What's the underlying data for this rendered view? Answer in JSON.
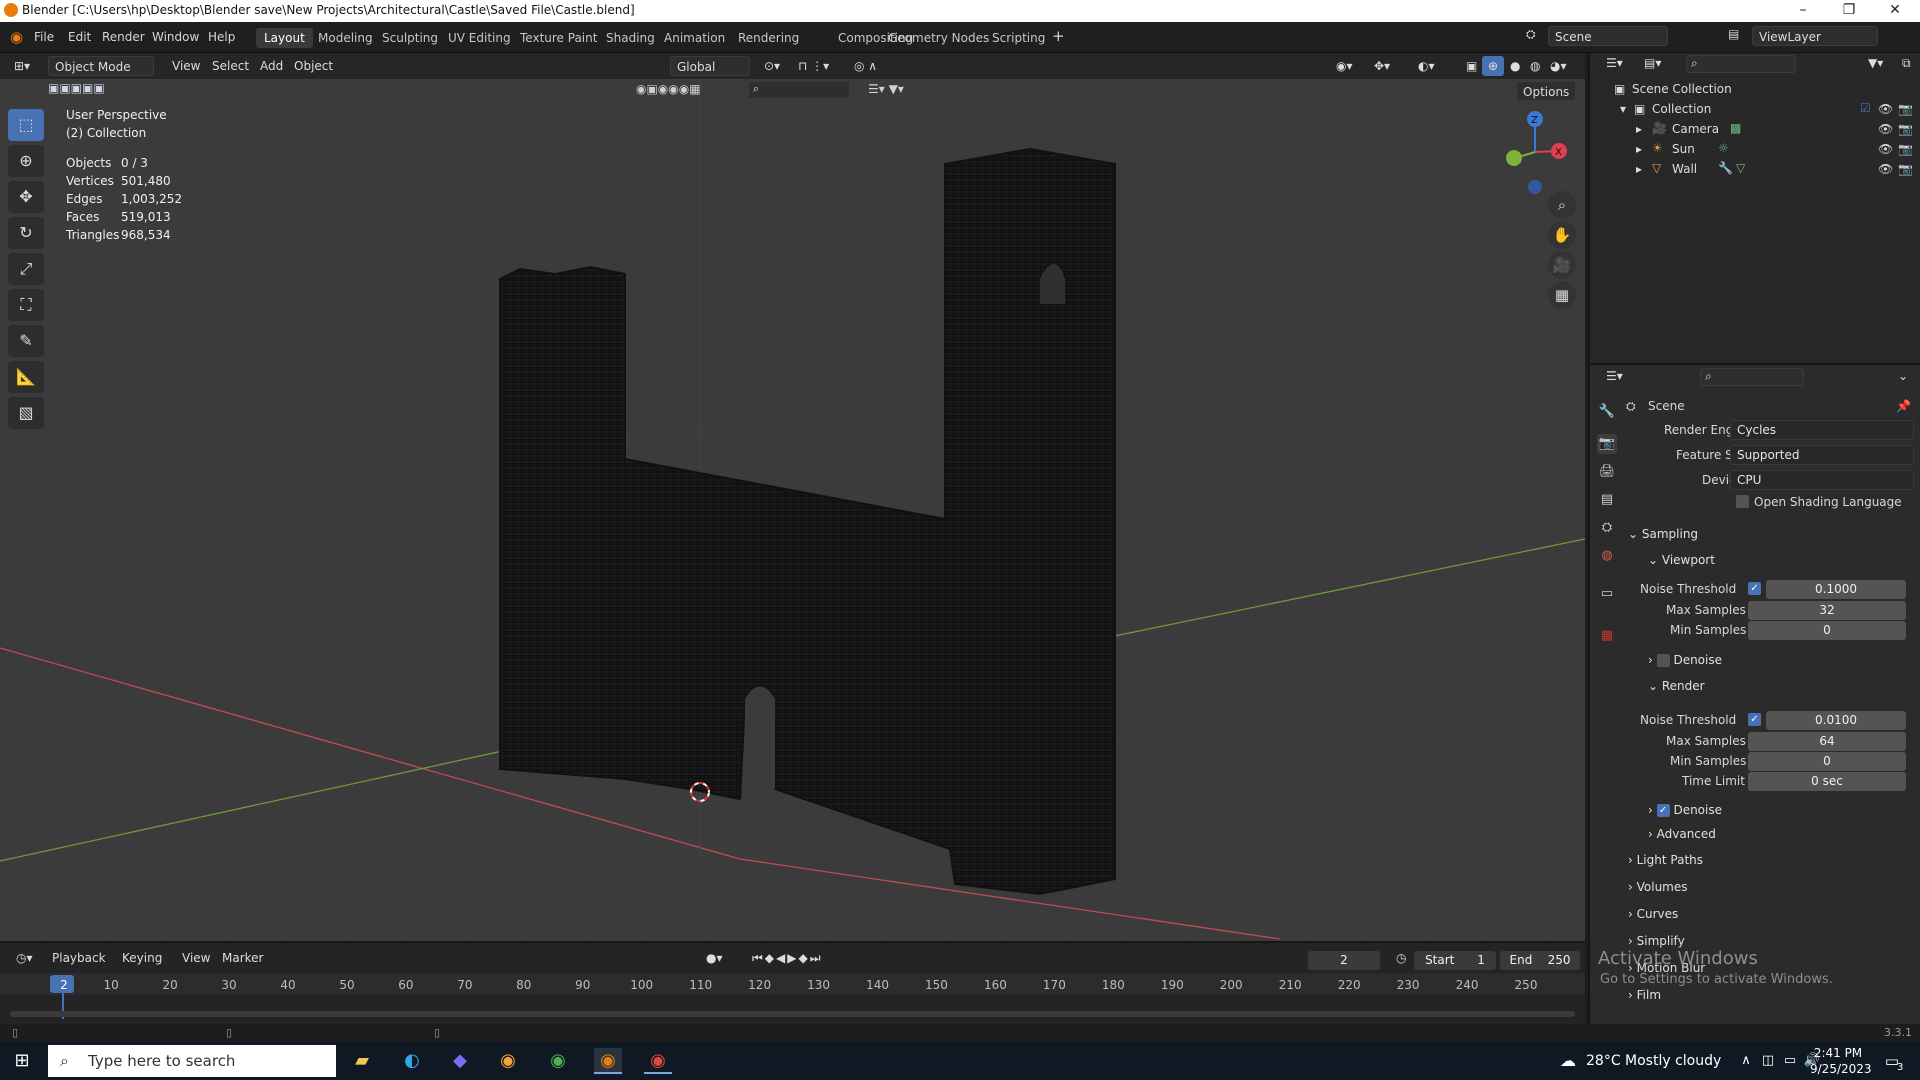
{
  "window": {
    "title": "Blender [C:\\Users\\hp\\Desktop\\Blender save\\New Projects\\Architectural\\Castle\\Saved File\\Castle.blend]"
  },
  "menu": [
    "File",
    "Edit",
    "Render",
    "Window",
    "Help"
  ],
  "workspaces": [
    "Layout",
    "Modeling",
    "Sculpting",
    "UV Editing",
    "Texture Paint",
    "Shading",
    "Animation",
    "Rendering",
    "Compositing",
    "Geometry Nodes",
    "Scripting"
  ],
  "active_workspace": "Layout",
  "top_right": {
    "scene": "Scene",
    "view_layer": "ViewLayer"
  },
  "viewport_header": {
    "mode": "Object Mode",
    "menus": [
      "View",
      "Select",
      "Add",
      "Object"
    ],
    "orientation": "Global",
    "options": "Options"
  },
  "overlay": {
    "view_name": "User Perspective",
    "collection": "(2) Collection",
    "stats": [
      {
        "label": "Objects",
        "value": "0 / 3"
      },
      {
        "label": "Vertices",
        "value": "501,480"
      },
      {
        "label": "Edges",
        "value": "1,003,252"
      },
      {
        "label": "Faces",
        "value": "519,013"
      },
      {
        "label": "Triangles",
        "value": "968,534"
      }
    ]
  },
  "outliner": {
    "root": "Scene Collection",
    "collection": "Collection",
    "items": [
      "Camera",
      "Sun",
      "Wall"
    ]
  },
  "properties": {
    "context": "Scene",
    "render_engine_label": "Render Engine",
    "render_engine": "Cycles",
    "feature_set_label": "Feature Set",
    "feature_set": "Supported",
    "device_label": "Device",
    "device": "CPU",
    "osl_label": "Open Shading Language",
    "sampling": "Sampling",
    "viewport": "Viewport",
    "vp_noise_label": "Noise Threshold",
    "vp_noise": "0.1000",
    "vp_max_label": "Max Samples",
    "vp_max": "32",
    "vp_min_label": "Min Samples",
    "vp_min": "0",
    "vp_denoise": "Denoise",
    "render": "Render",
    "r_noise_label": "Noise Threshold",
    "r_noise": "0.0100",
    "r_max_label": "Max Samples",
    "r_max": "64",
    "r_min_label": "Min Samples",
    "r_min": "0",
    "r_time_label": "Time Limit",
    "r_time": "0 sec",
    "r_denoise": "Denoise",
    "advanced": "Advanced",
    "light_paths": "Light Paths",
    "volumes": "Volumes",
    "curves": "Curves",
    "simplify": "Simplify",
    "motion_blur": "Motion Blur",
    "film": "Film"
  },
  "timeline": {
    "menus": [
      "Playback",
      "Keying",
      "View",
      "Marker"
    ],
    "current_frame": "2",
    "start_label": "Start",
    "start": "1",
    "end_label": "End",
    "end": "250",
    "ticks": [
      "2",
      "10",
      "20",
      "30",
      "40",
      "50",
      "60",
      "70",
      "80",
      "90",
      "100",
      "110",
      "120",
      "130",
      "140",
      "150",
      "160",
      "170",
      "180",
      "190",
      "200",
      "210",
      "220",
      "230",
      "240",
      "250"
    ]
  },
  "status": {
    "version": "3.3.1"
  },
  "watermark": {
    "line1": "Activate Windows",
    "line2": "Go to Settings to activate Windows."
  },
  "taskbar": {
    "search_placeholder": "Type here to search",
    "weather": "28°C  Mostly cloudy",
    "time": "2:41 PM",
    "date": "9/25/2023",
    "notification_count": "3"
  },
  "colors": {
    "accent": "#4772b3",
    "x_axis": "#e13e4f",
    "y_axis": "#80b13a",
    "z_axis": "#3a79d6"
  }
}
